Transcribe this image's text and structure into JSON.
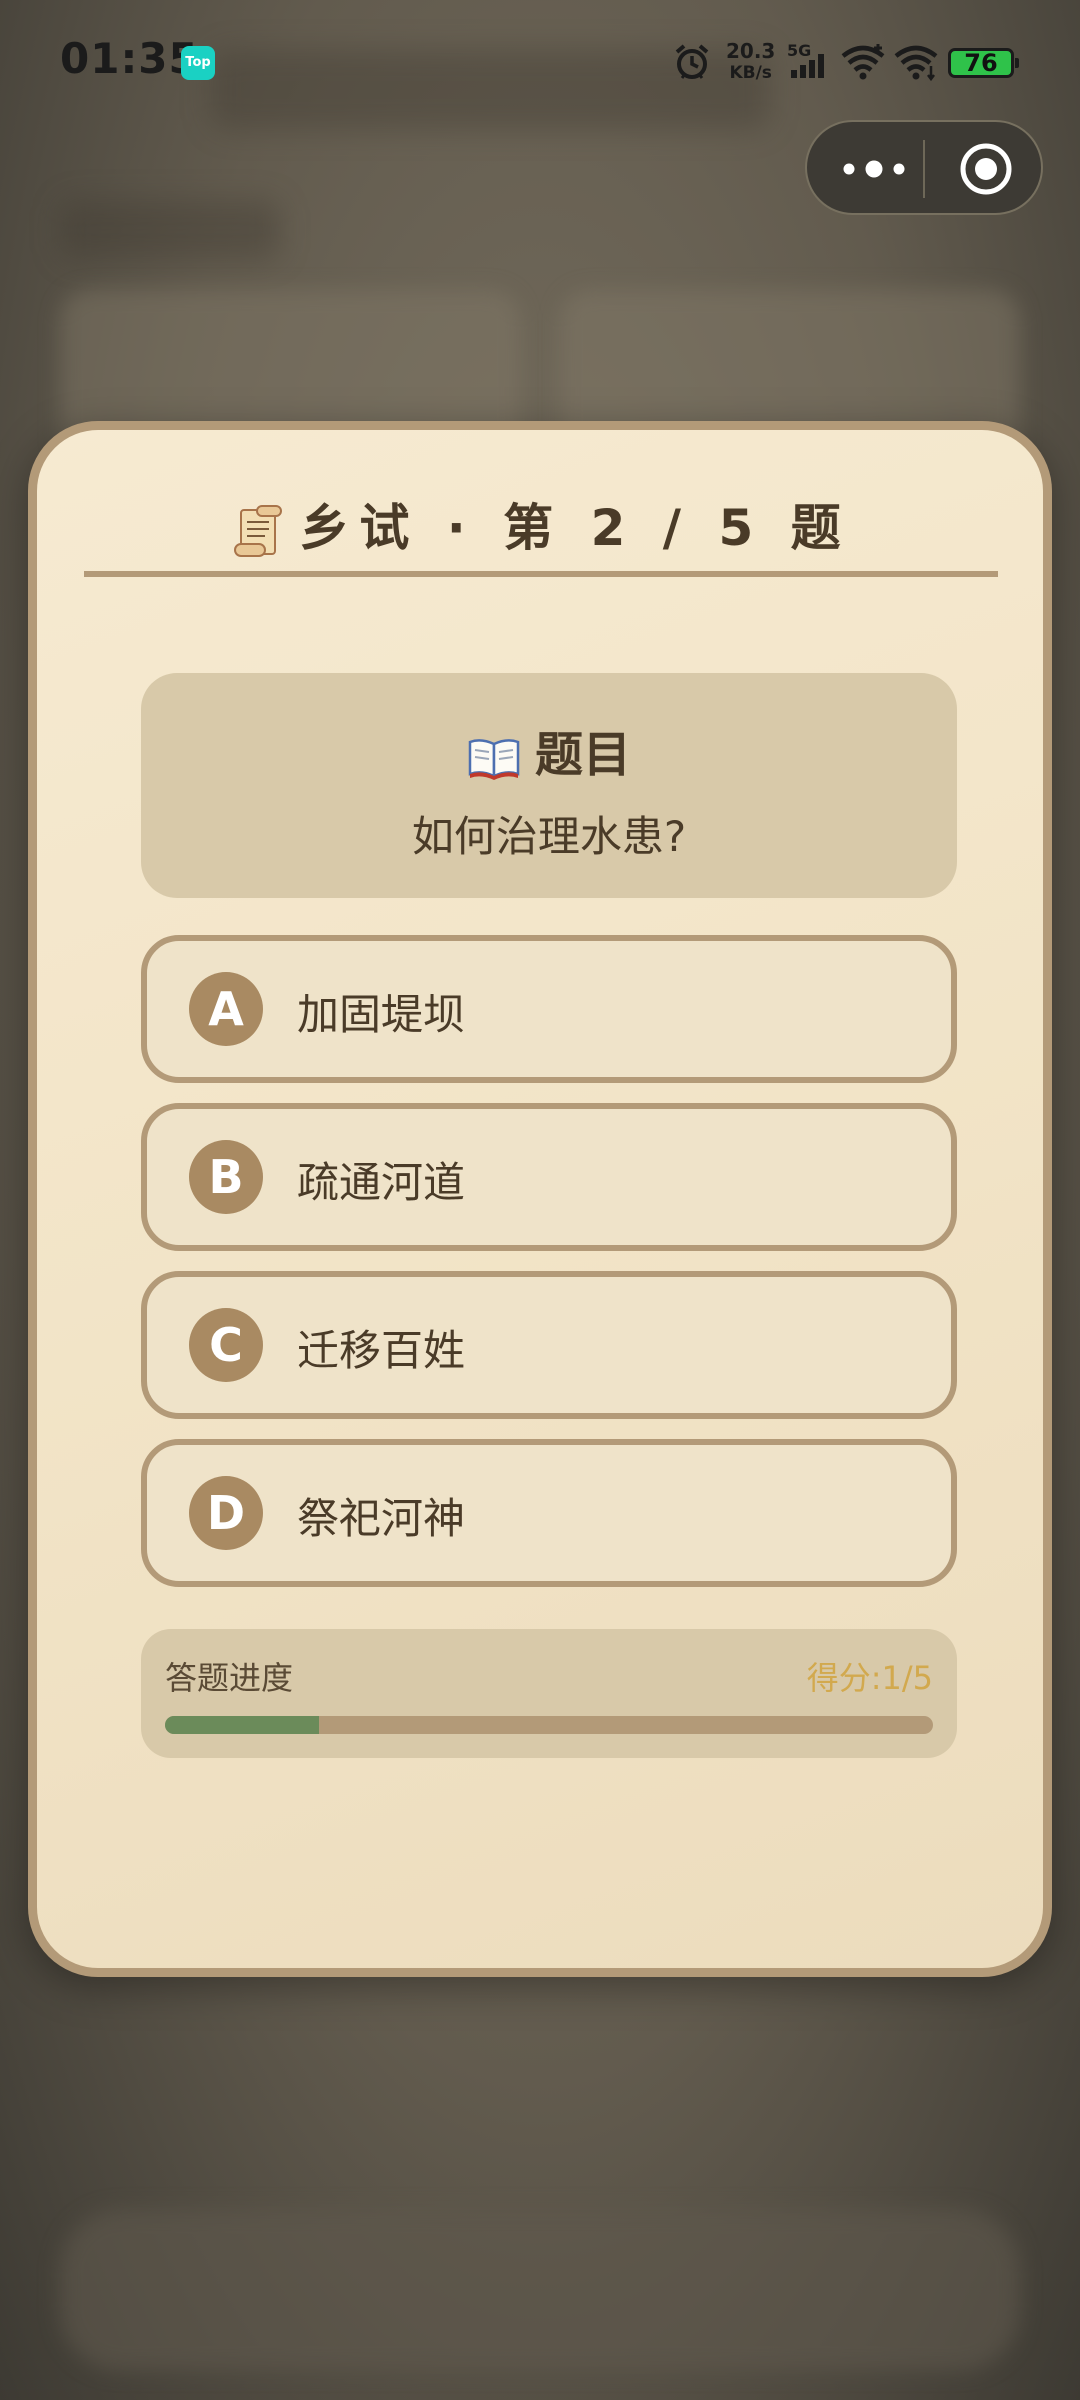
{
  "status_bar": {
    "time": "01:35",
    "app_badge": "Top",
    "net_speed_value": "20.3",
    "net_speed_unit": "KB/s",
    "network_type": "5G",
    "battery_level": "76",
    "icons": [
      "alarm-icon",
      "signal-icon",
      "wifi-icon",
      "wifi-icon",
      "battery-icon"
    ]
  },
  "capsule": {
    "icons": [
      "more-dots-icon",
      "target-close-icon"
    ]
  },
  "modal": {
    "title": "乡试 · 第 2 / 5 题",
    "title_icon": "scroll-icon",
    "question": {
      "heading": "题目",
      "heading_icon": "open-book-icon",
      "text": "如何治理水患?"
    },
    "options": [
      {
        "letter": "A",
        "text": "加固堤坝"
      },
      {
        "letter": "B",
        "text": "疏通河道"
      },
      {
        "letter": "C",
        "text": "迁移百姓"
      },
      {
        "letter": "D",
        "text": "祭祀河神"
      }
    ],
    "progress": {
      "label": "答题进度",
      "score": "得分:1/5",
      "fraction": 0.2
    }
  },
  "colors": {
    "accent": "#b39a78",
    "text": "#4a3b28",
    "score": "#d2a94e",
    "progress_fill": "#6b8b5a"
  }
}
